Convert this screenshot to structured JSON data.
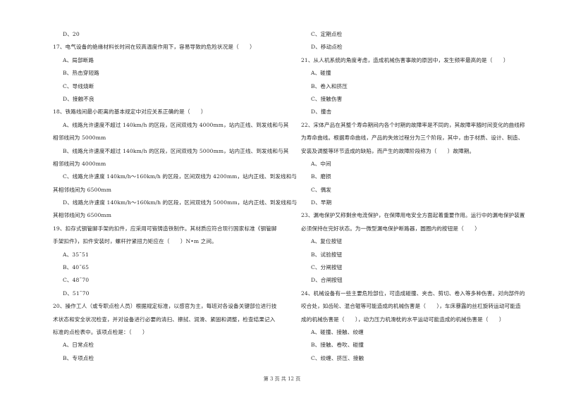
{
  "left_column": [
    {
      "type": "opt",
      "text": "D、20"
    },
    {
      "type": "q",
      "text": "17、电气设备的绝缘材料长时间在较高温度作用下，容易导致的危险状况是（　　）"
    },
    {
      "type": "opt",
      "text": "A、局部断路"
    },
    {
      "type": "opt",
      "text": "B、热击穿短路"
    },
    {
      "type": "opt",
      "text": "C、导线烧断"
    },
    {
      "type": "opt",
      "text": "D、接触不良"
    },
    {
      "type": "q",
      "text": "18、铁路线间最小距离的基本规定中对应关系正确的是（　　）"
    },
    {
      "type": "para",
      "text": "A、线路允许速度不超过 140km/h 的区段，区间双线为 4000mm，站内正线、到发线和与其"
    },
    {
      "type": "q",
      "text": "相邻线间为 5000mm"
    },
    {
      "type": "para",
      "text": "B、线路允许速度不超过 140km/h 的区段，区间双线为 5000mm，站内正线、到发线和与其"
    },
    {
      "type": "q",
      "text": "相邻线间为 4000mm"
    },
    {
      "type": "para",
      "text": "C、线路允许速度 140km/h～160km/h 的区段，区间双线为 4200mm，站内正线、到发线和与"
    },
    {
      "type": "q",
      "text": "其相邻线间为 6500mm"
    },
    {
      "type": "para",
      "text": "D、线路允许速度 140km/h～160km/h 的区段，区间双线为 5000mm，站内正线、到发线和与"
    },
    {
      "type": "q",
      "text": "其相邻线间为 6500mm"
    },
    {
      "type": "q",
      "text": "19、扣存式钢管脚手架的扣件，应采用可锻铸造铁制作。其材质应符合现行国家标准《钢管脚"
    },
    {
      "type": "q",
      "text": "手架扣件》，扣件安装时，螺杆拧紧扭力矩应在（　　）N•m 之间。"
    },
    {
      "type": "opt",
      "text": "A、35˜51"
    },
    {
      "type": "opt",
      "text": "B、40˜65"
    },
    {
      "type": "opt",
      "text": "C、48˜70"
    },
    {
      "type": "opt",
      "text": "D、51˜70"
    },
    {
      "type": "q",
      "text": "20、操作工人（或专职点检人员）根据规定标准，以感官为主，每班对各设备关键部位进行技"
    },
    {
      "type": "q",
      "text": "术状态和安全状况检查，并对设备进行必要的清扫、擦拭、润滑、紧固和调整，检查结果记入"
    },
    {
      "type": "q",
      "text": "标准的点检表中。该项点检是：（　　）"
    },
    {
      "type": "opt",
      "text": "A、日常点检"
    },
    {
      "type": "opt",
      "text": "B、专项点检"
    }
  ],
  "right_column": [
    {
      "type": "opt",
      "text": "C、定期点检"
    },
    {
      "type": "opt",
      "text": "D、移动点检"
    },
    {
      "type": "q",
      "text": "21、从人机系统的角度考虑，造成机械伤害事故的原因中，发生频率最高的是（　　）"
    },
    {
      "type": "opt",
      "text": "A、碰撞"
    },
    {
      "type": "opt",
      "text": "B、卷入和挤压"
    },
    {
      "type": "opt",
      "text": "C、接触伤害"
    },
    {
      "type": "opt",
      "text": "D、撞击"
    },
    {
      "type": "q",
      "text": "22、宋体产品在其整个寿命期间内各个时期的故障率是不同的，其故障率随时间变化的曲线称"
    },
    {
      "type": "q",
      "text": "为寿命曲线。根据寿命曲线，产品的失效过程分为三个阶段，其中，由于材质、设计、制造、"
    },
    {
      "type": "q",
      "text": "安装及调整等环节造成的缺陷，而产生的故障阶段称为（　　）故障期。"
    },
    {
      "type": "opt",
      "text": "A、中间"
    },
    {
      "type": "opt",
      "text": "B、磨损"
    },
    {
      "type": "opt",
      "text": "C、偶发"
    },
    {
      "type": "opt",
      "text": "D、早期"
    },
    {
      "type": "q",
      "text": "23、漏电保护又称剩余电流保护，在保障用电安全方面起着重要作用。运行中的漏电保护装置"
    },
    {
      "type": "q",
      "text": "必须保持在完好状态。为一微型漏电保护断路器，圆圈内的按钮是（　　）"
    },
    {
      "type": "opt",
      "text": "A、复位按钮"
    },
    {
      "type": "opt",
      "text": "B、试验按钮"
    },
    {
      "type": "opt",
      "text": "C、分闸按钮"
    },
    {
      "type": "opt",
      "text": "D、合闸按钮"
    },
    {
      "type": "q",
      "text": "24、机械设备有一些主要危险部位，可造成碰撞、夹击、剪切、卷入等多种伤害。对向部件的"
    },
    {
      "type": "q",
      "text": "咬合处，如齿轮、混合辊等可能造成的机械伤害是（　　），车床暴露的丝杠旋转运动可能造"
    },
    {
      "type": "q",
      "text": "成的机械伤害是（　　），动力压力机滑枕的水平运动可能造成的机械伤害是（　　）"
    },
    {
      "type": "opt",
      "text": "A、碰撞、接触、绞缠"
    },
    {
      "type": "opt",
      "text": "B、接触、卷吹、碰撞"
    },
    {
      "type": "opt",
      "text": "C、绞缠、挤压、接触"
    }
  ],
  "footer": {
    "page_label": "第 3 页 共 12 页"
  }
}
